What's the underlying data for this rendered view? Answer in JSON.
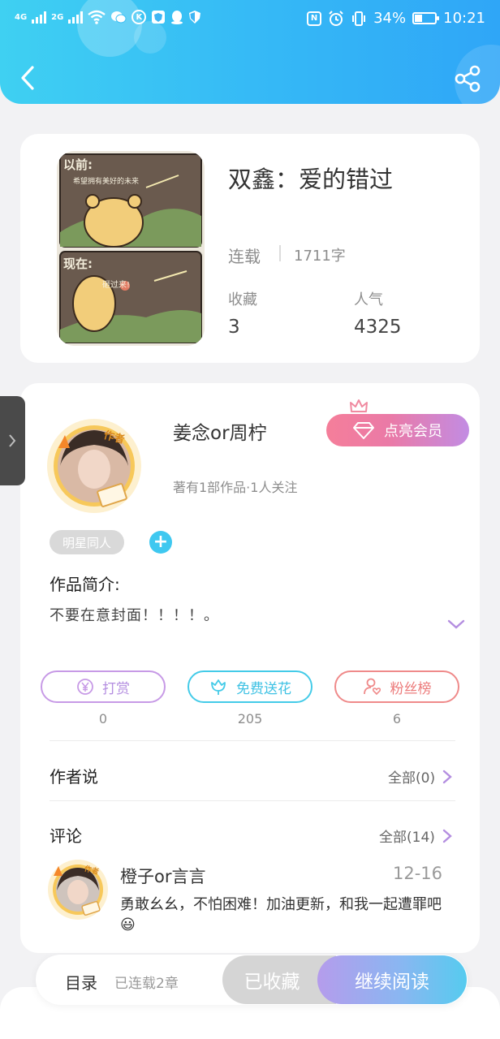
{
  "status_bar": {
    "network_1": "4G",
    "network_2": "2G",
    "nfc": "N",
    "battery": "34%",
    "time": "10:21"
  },
  "book": {
    "title": "双鑫：爱的错过",
    "status": "连载",
    "word_count": "1711字",
    "favorites_label": "收藏",
    "favorites": "3",
    "popularity_label": "人气",
    "popularity": "4325",
    "cover": {
      "top_label": "以前:",
      "top_caption": "希望拥有美好的未来",
      "bottom_label": "现在:",
      "bottom_caption": "砸过来!"
    }
  },
  "author": {
    "name": "姜念or周柠",
    "badge": "作者",
    "meta": "著有1部作品·1人关注",
    "vip_label": "点亮会员",
    "tag": "明星同人"
  },
  "intro": {
    "title": "作品简介:",
    "text": "不要在意封面！！！！。"
  },
  "actions": [
    {
      "label": "打赏",
      "count": "0",
      "color": "#c79ae6"
    },
    {
      "label": "免费送花",
      "count": "205",
      "color": "#44cbe8"
    },
    {
      "label": "粉丝榜",
      "count": "6",
      "color": "#ef8a8a"
    }
  ],
  "author_says": {
    "title": "作者说",
    "link": "全部(0)"
  },
  "comments": {
    "title": "评论",
    "link": "全部(14)",
    "first": {
      "user": "橙子or言言",
      "badge": "作者",
      "date": "12-16",
      "text": "勇敢幺幺，不怕困难！加油更新，和我一起遭罪吧😃"
    }
  },
  "bottom_bar": {
    "toc_label": "目录",
    "toc_sub": "已连载2章",
    "collected_label": "已收藏",
    "read_label": "继续阅读"
  },
  "colors": {
    "header_start": "#3fd0f2",
    "header_end": "#2fa6f7",
    "vip_start": "#f57e9a",
    "vip_end": "#c28ce3",
    "accent_purple": "#b48ee0"
  }
}
